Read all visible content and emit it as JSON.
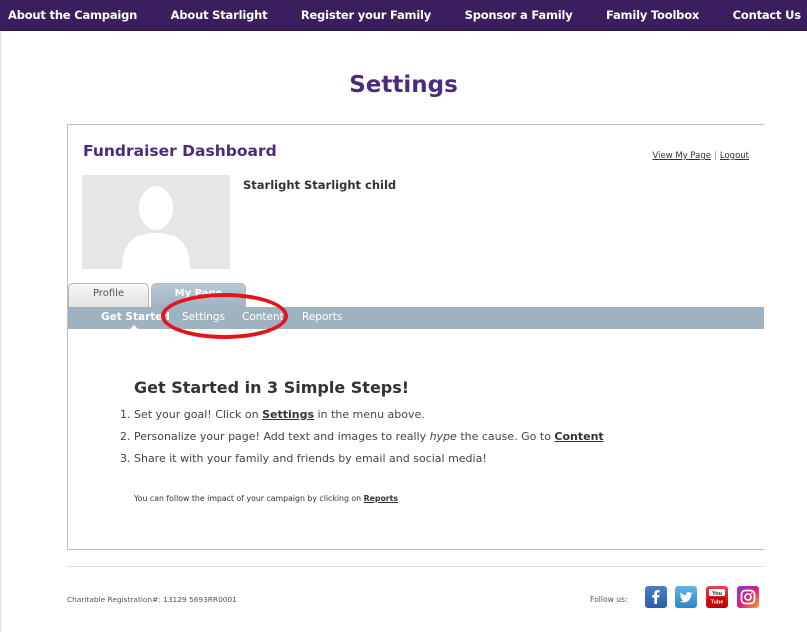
{
  "nav": {
    "items": [
      "About the Campaign",
      "About Starlight",
      "Register your Family",
      "Sponsor a Family",
      "Family Toolbox",
      "Contact Us"
    ]
  },
  "page": {
    "title": "Settings"
  },
  "dashboard": {
    "title": "Fundraiser Dashboard",
    "view_my_page": "View My Page",
    "logout": "Logout",
    "user_name": "Starlight Starlight child"
  },
  "tabs": {
    "profile": "Profile",
    "my_page": "My Page"
  },
  "subnav": {
    "items": [
      "Get Started",
      "Settings",
      "Content",
      "Reports"
    ]
  },
  "get_started": {
    "title": "Get Started in 3 Simple Steps!",
    "step1_pre": "1. Set your goal! Click on ",
    "step1_link": "Settings",
    "step1_post": " in the menu above.",
    "step2_pre": "2. Personalize your page! Add text and images to really ",
    "step2_em": "hype",
    "step2_mid": " the cause. Go to ",
    "step2_link": "Content",
    "step3": "3. Share it with your family and friends by email and social media!",
    "followup_pre": "You can follow the impact of your campaign by clicking on ",
    "followup_link": "Reports"
  },
  "footer": {
    "registration": "Charitable Registration#: 13129 5693RR0001",
    "follow_us": "Follow us:"
  },
  "colors": {
    "brand": "#3b1e5e",
    "title": "#4b2c7a",
    "subnav": "#9fb2bf",
    "highlight": "#e3141c"
  },
  "icons": [
    "facebook-icon",
    "twitter-icon",
    "youtube-icon",
    "instagram-icon",
    "avatar-placeholder-icon"
  ]
}
